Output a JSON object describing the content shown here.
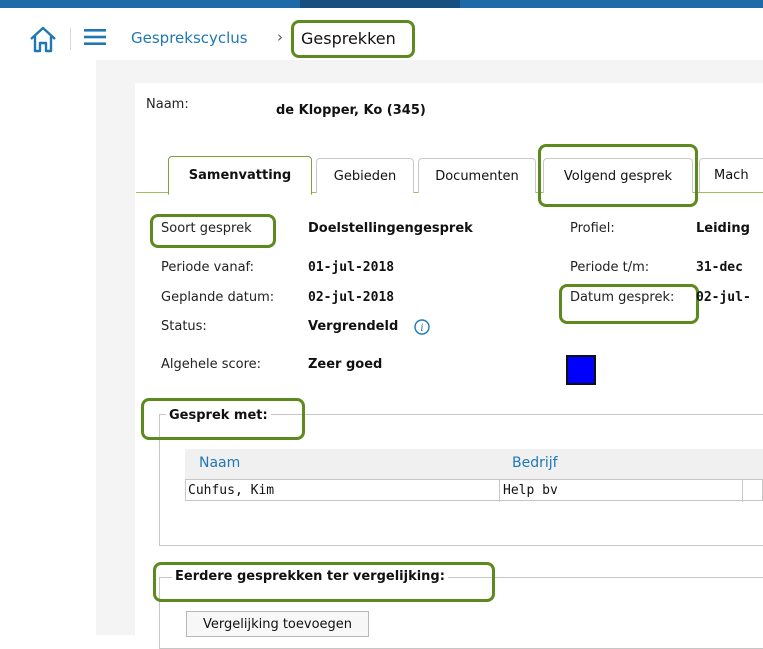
{
  "breadcrumb": {
    "parent": "Gesprekscyclus",
    "current": "Gesprekken",
    "separator": "›"
  },
  "employee": {
    "label": "Naam:",
    "value": "de Klopper, Ko (345)"
  },
  "tabs": [
    {
      "label": "Samenvatting",
      "active": true
    },
    {
      "label": "Gebieden"
    },
    {
      "label": "Documenten"
    },
    {
      "label": "Volgend gesprek"
    },
    {
      "label": "Mach"
    }
  ],
  "summary": {
    "soort_label": "Soort gesprek",
    "soort_value": "Doelstellingengesprek",
    "profiel_label": "Profiel:",
    "profiel_value": "Leiding",
    "periode_vanaf_label": "Periode vanaf:",
    "periode_vanaf_value": "01-jul-2018",
    "periode_tm_label": "Periode t/m:",
    "periode_tm_value": "31-dec",
    "geplande_label": "Geplande datum:",
    "geplande_value": "02-jul-2018",
    "datum_label": "Datum gesprek:",
    "datum_value": "02-jul-",
    "status_label": "Status:",
    "status_value": "Vergrendeld",
    "score_label": "Algehele score:",
    "score_value": "Zeer goed",
    "score_color": "#0000ff"
  },
  "gesprek_met": {
    "title": "Gesprek met:",
    "columns": [
      "Naam",
      "Bedrijf"
    ],
    "rows": [
      {
        "naam": "Cuhfus, Kim",
        "bedrijf": "Help bv"
      }
    ]
  },
  "eerdere": {
    "title": "Eerdere gesprekken ter vergelijking:",
    "button": "Vergelijking toevoegen"
  },
  "colors": {
    "accent": "#1f78b4",
    "highlight": "#5d8a1e",
    "topbar": "#1e6aa8"
  }
}
